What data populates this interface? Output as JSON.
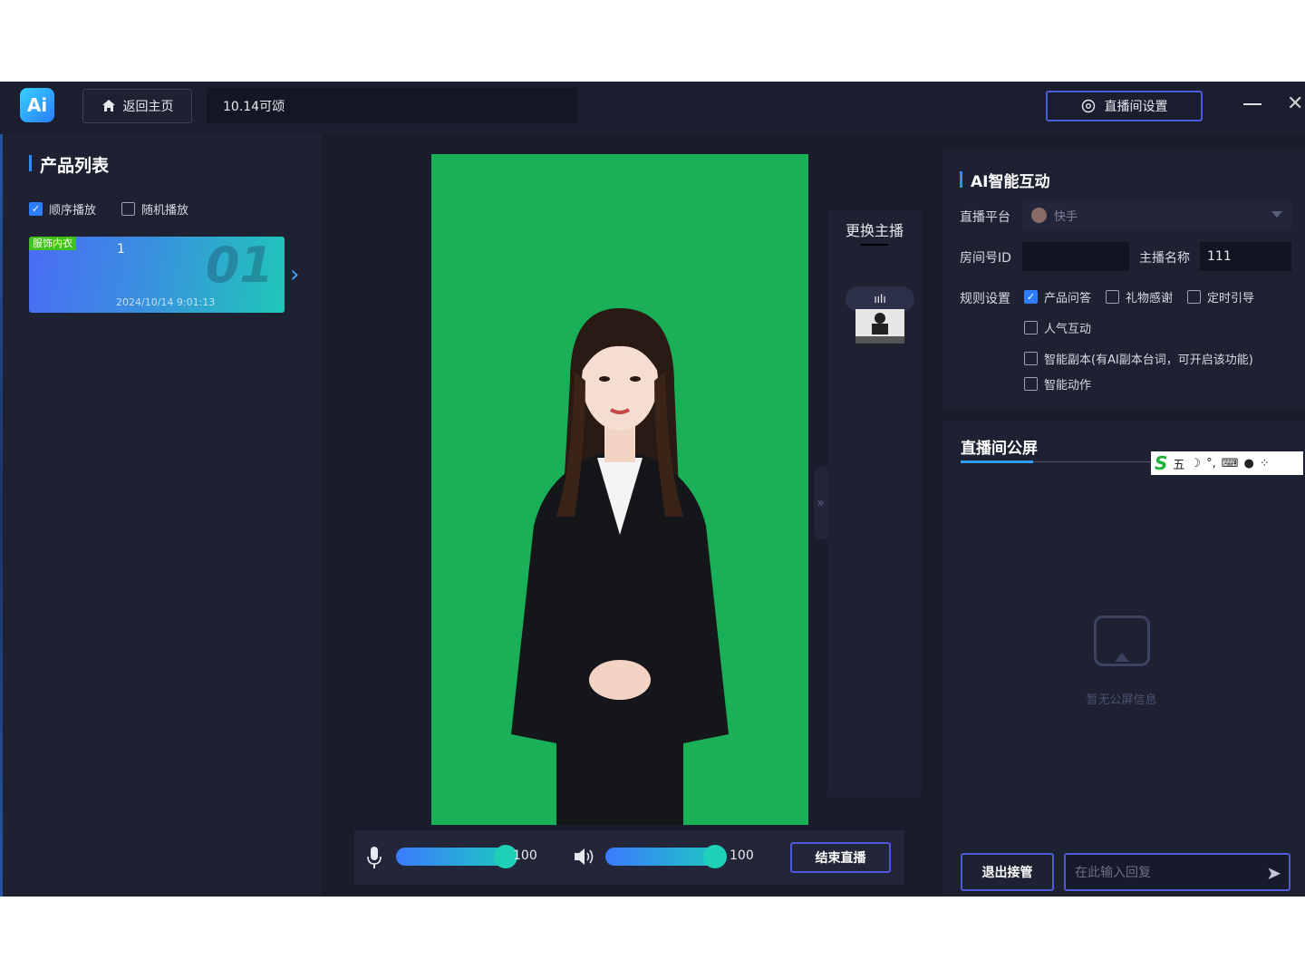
{
  "header": {
    "logo_text": "Ai",
    "home_label": "返回主页",
    "room_title": "10.14可颂",
    "settings_label": "直播间设置"
  },
  "product_list": {
    "title": "产品列表",
    "sequential_label": "顺序播放",
    "random_label": "随机播放",
    "sequential_checked": true,
    "random_checked": false,
    "items": [
      {
        "tag": "服饰内衣",
        "name": "1",
        "index": "01",
        "time": "2024/10/14 9:01:13"
      }
    ]
  },
  "host": {
    "change_label": "更换主播",
    "pill_icon": "audio-bars-icon"
  },
  "controls": {
    "mic_value": "100",
    "speaker_value": "100",
    "end_label": "结束直播"
  },
  "ai": {
    "title": "AI智能互动",
    "platform_label": "直播平台",
    "platform_value": "快手",
    "room_id_label": "房间号ID",
    "room_id_value": "",
    "host_name_label": "主播名称",
    "host_name_value": "111",
    "rules_label": "规则设置",
    "rules": [
      {
        "label": "产品问答",
        "checked": true
      },
      {
        "label": "礼物感谢",
        "checked": false
      },
      {
        "label": "定时引导",
        "checked": false
      },
      {
        "label": "人气互动",
        "checked": false
      },
      {
        "label": "智能副本(有AI副本台词，可开启该功能)",
        "checked": false
      },
      {
        "label": "智能动作",
        "checked": false
      }
    ]
  },
  "screen": {
    "title": "直播间公屏",
    "empty_text": "暂无公屏信息",
    "exit_label": "退出接管",
    "reply_placeholder": "在此输入回复"
  },
  "ime": {
    "logo": "S",
    "mode": "五"
  },
  "colors": {
    "accent": "#4d5bd8",
    "green_screen": "#1ab057",
    "bg": "#1a1c2c"
  }
}
